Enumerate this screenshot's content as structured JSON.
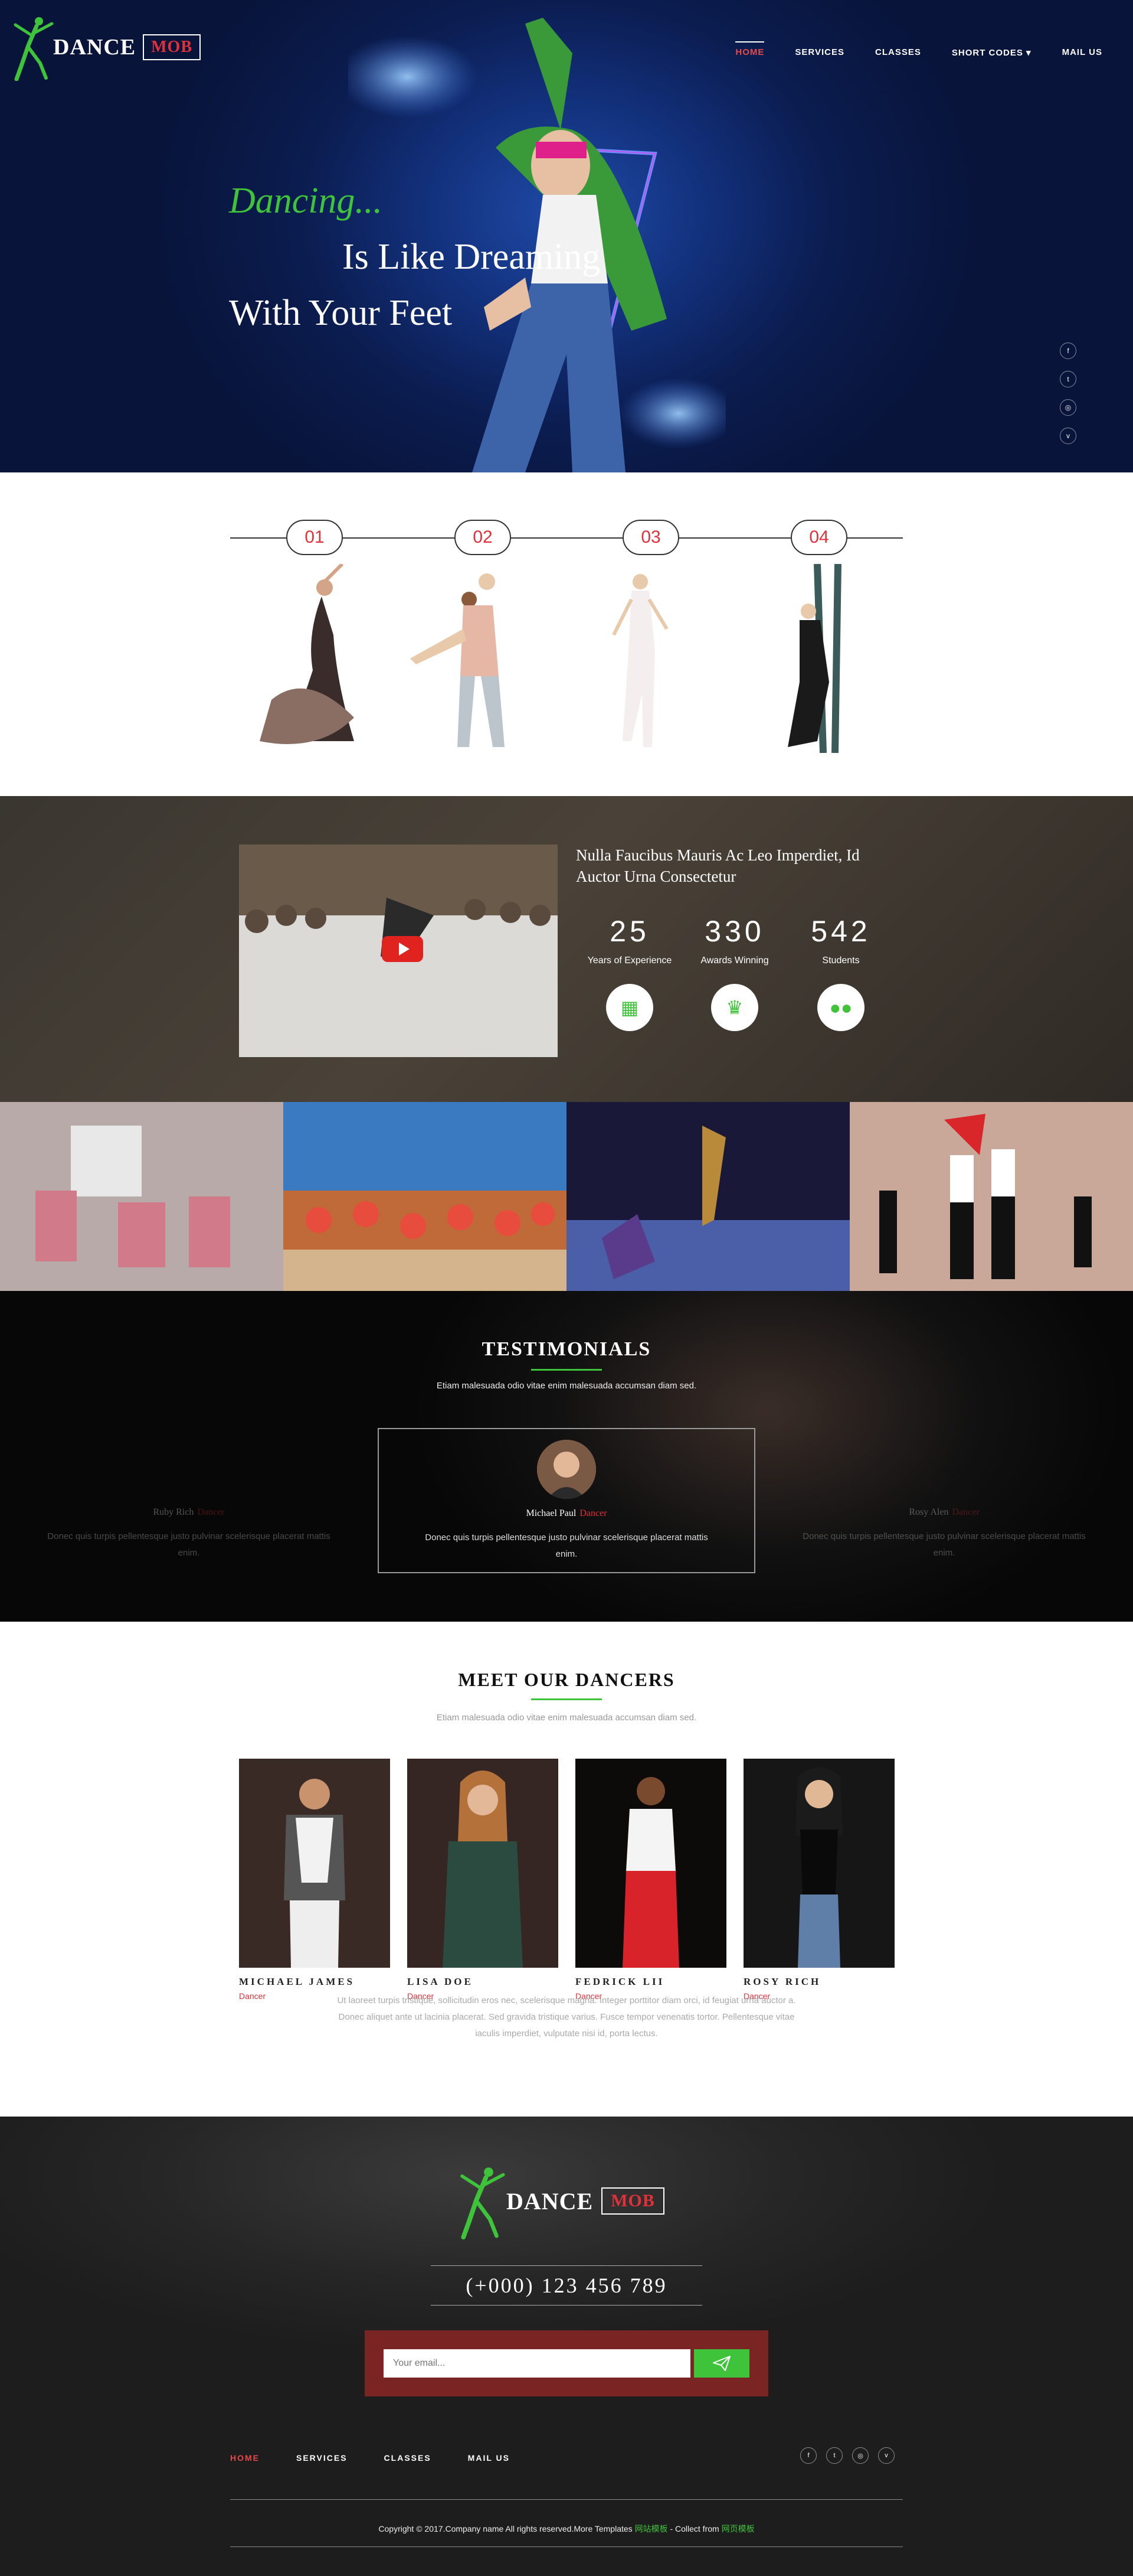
{
  "brand": {
    "word": "DANCE",
    "box": "MOB"
  },
  "nav": [
    {
      "label": "HOME",
      "active": true
    },
    {
      "label": "SERVICES",
      "active": false
    },
    {
      "label": "CLASSES",
      "active": false
    },
    {
      "label": "SHORT CODES ▾",
      "active": false
    },
    {
      "label": "MAIL US",
      "active": false
    }
  ],
  "hero": {
    "line1": "Dancing...",
    "line2": "Is Like Dreaming",
    "line3": "With Your Feet"
  },
  "social_icons": [
    "facebook-icon",
    "twitter-icon",
    "instagram-icon",
    "vimeo-icon"
  ],
  "steps": [
    "01",
    "02",
    "03",
    "04"
  ],
  "stats": {
    "title": "Nulla Faucibus Mauris Ac Leo Imperdiet, Id Auctor Urna Consectetur",
    "items": [
      {
        "value": "25",
        "label": "Years of Experience",
        "icon": "calendar-icon"
      },
      {
        "value": "330",
        "label": "Awards Winning",
        "icon": "trophy-icon"
      },
      {
        "value": "542",
        "label": "Students",
        "icon": "users-icon"
      }
    ]
  },
  "testimonials": {
    "heading": "TESTIMONIALS",
    "subtitle": "Etiam malesuada odio vitae enim malesuada accumsan diam sed.",
    "cards": [
      {
        "name": "Ruby Rich",
        "role": "Dancer",
        "text": "Donec quis turpis pellentesque justo pulvinar scelerisque placerat mattis enim."
      },
      {
        "name": "Michael Paul",
        "role": "Dancer",
        "text": "Donec quis turpis pellentesque justo pulvinar scelerisque placerat mattis enim."
      },
      {
        "name": "Rosy Alen",
        "role": "Dancer",
        "text": "Donec quis turpis pellentesque justo pulvinar scelerisque placerat mattis enim."
      }
    ]
  },
  "dancers": {
    "heading": "MEET OUR DANCERS",
    "subtitle": "Etiam malesuada odio vitae enim malesuada accumsan diam sed.",
    "members": [
      {
        "name": "MICHAEL JAMES",
        "role": "Dancer"
      },
      {
        "name": "LISA DOE",
        "role": "Dancer"
      },
      {
        "name": "FEDRICK LII",
        "role": "Dancer"
      },
      {
        "name": "ROSY RICH",
        "role": "Dancer"
      }
    ],
    "paragraph": "Ut laoreet turpis tristique, sollicitudin eros nec, scelerisque magna. Integer porttitor diam orci, id feugiat urna auctor a. Donec aliquet ante ut lacinia placerat. Sed gravida tristique varius. Fusce tempor venenatis tortor. Pellentesque vitae iaculis imperdiet, vulputate nisi id, porta lectus."
  },
  "footer": {
    "phone": "(+000) 123 456 789",
    "email_placeholder": "Your email...",
    "nav": [
      {
        "label": "HOME",
        "active": true
      },
      {
        "label": "SERVICES",
        "active": false
      },
      {
        "label": "CLASSES",
        "active": false
      },
      {
        "label": "MAIL US",
        "active": false
      }
    ],
    "copyright_prefix": "Copyright © 2017.Company name All rights reserved.More Templates ",
    "copyright_link1": "网站模板",
    "copyright_mid": " - Collect from ",
    "copyright_link2": "网页模板"
  },
  "colors": {
    "accent_green": "#3ec33a",
    "accent_red": "#e0313a",
    "hero_blue": "#0b1c4f"
  }
}
